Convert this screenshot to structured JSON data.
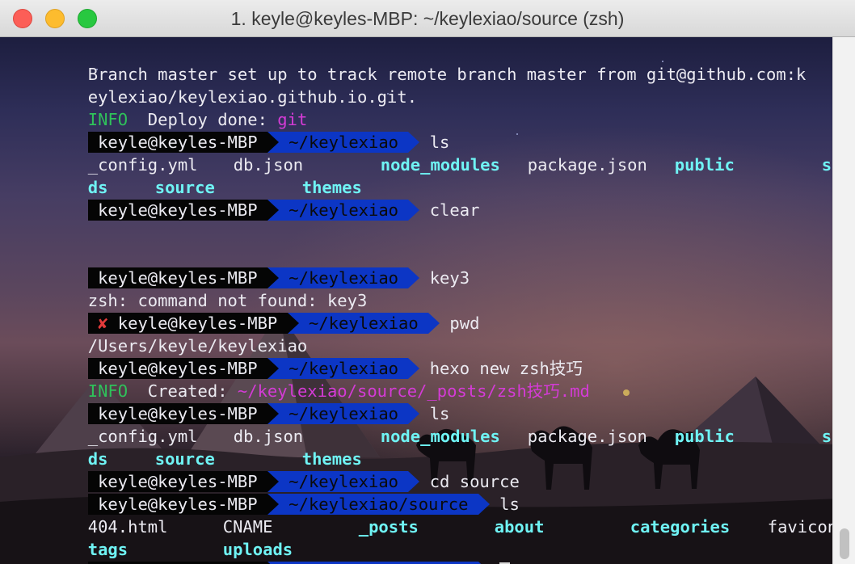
{
  "window": {
    "title": "1. keyle@keyles-MBP: ~/keylexiao/source (zsh)"
  },
  "prompt": {
    "user": " keyle@keyles-MBP ",
    "error_mark": "✘",
    "dir_home": " ~/keylexiao ",
    "dir_source": " ~/keylexiao/source "
  },
  "output": {
    "branch_line_1": "Branch master set up to track remote branch master from git@github.com:k",
    "branch_line_2": "eylexiao/keylexiao.github.io.git.",
    "info_label": "INFO",
    "deploy_text": "  Deploy done: ",
    "deploy_target": "git",
    "zsh_error": "zsh: command not found: key3",
    "pwd_result": "/Users/keyle/keylexiao",
    "created_text": "  Created: ",
    "created_path": "~/keylexiao/source/_posts/zsh技巧.md"
  },
  "commands": {
    "ls": " ls",
    "clear": " clear",
    "key3": " key3",
    "pwd": " pwd",
    "hexo_new": " hexo new zsh技巧",
    "cd_source": " cd source"
  },
  "listing_root": {
    "row1": {
      "config": "_config.yml",
      "db": "db.json",
      "node_modules": "node_modules",
      "package": "package.json",
      "public": "public",
      "scaffol": "scaffol"
    },
    "row2": {
      "ds": "ds",
      "source": "source",
      "themes": "themes"
    }
  },
  "listing_source": {
    "row1": {
      "html404": "404.html",
      "cname": "CNAME",
      "posts": "_posts",
      "about": "about",
      "categories": "categories",
      "favicon": "favicon.ico"
    },
    "row2": {
      "tags": "tags",
      "uploads": "uploads"
    }
  },
  "colors": {
    "prompt_user_bg": "#050505",
    "prompt_dir_bg": "#0c36c5",
    "info_green": "#2fc25a",
    "path_magenta": "#d43bd6",
    "dir_cyan": "#6ff3f4",
    "error_red": "#e23a3a"
  }
}
